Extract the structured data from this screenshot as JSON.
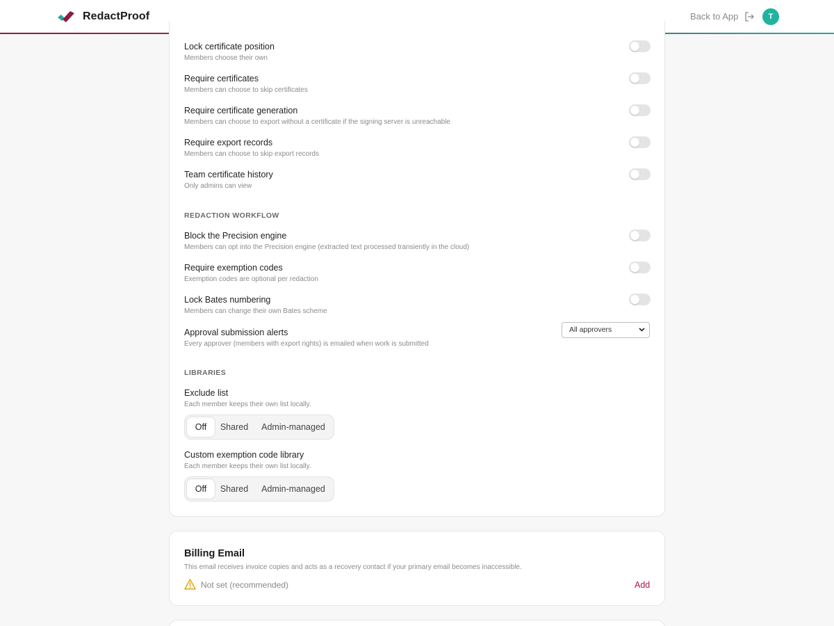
{
  "header": {
    "brand": "RedactProof",
    "back_label": "Back to App",
    "avatar_initial": "T"
  },
  "colors": {
    "brand_maroon": "#8a1c3c",
    "brand_teal": "#1fb3a0",
    "link_red": "#b3124a",
    "warning": "#e3a008"
  },
  "certificates": {
    "rows": [
      {
        "title": "Lock certificate position",
        "desc": "Members choose their own",
        "on": false
      },
      {
        "title": "Require certificates",
        "desc": "Members can choose to skip certificates",
        "on": false
      },
      {
        "title": "Require certificate generation",
        "desc": "Members can choose to export without a certificate if the signing server is unreachable",
        "on": false
      },
      {
        "title": "Require export records",
        "desc": "Members can choose to skip export records",
        "on": false
      },
      {
        "title": "Team certificate history",
        "desc": "Only admins can view",
        "on": false
      }
    ]
  },
  "workflow": {
    "section_label": "REDACTION WORKFLOW",
    "rows": [
      {
        "title": "Block the Precision engine",
        "desc": "Members can opt into the Precision engine (extracted text processed transiently in the cloud)",
        "on": false
      },
      {
        "title": "Require exemption codes",
        "desc": "Exemption codes are optional per redaction",
        "on": false
      },
      {
        "title": "Lock Bates numbering",
        "desc": "Members can change their own Bates scheme",
        "on": false
      }
    ],
    "alerts": {
      "title": "Approval submission alerts",
      "desc": "Every approver (members with export rights) is emailed when work is submitted",
      "selected": "All approvers"
    }
  },
  "libraries": {
    "section_label": "LIBRARIES",
    "exclude": {
      "title": "Exclude list",
      "desc": "Each member keeps their own list locally.",
      "options": [
        "Off",
        "Shared",
        "Admin-managed"
      ],
      "selected": "Off"
    },
    "exemption": {
      "title": "Custom exemption code library",
      "desc": "Each member keeps their own list locally.",
      "options": [
        "Off",
        "Shared",
        "Admin-managed"
      ],
      "selected": "Off"
    }
  },
  "billing": {
    "title": "Billing Email",
    "desc": "This email receives invoice copies and acts as a recovery contact if your primary email becomes inaccessible.",
    "status": "Not set (recommended)",
    "add_label": "Add",
    "icon": "warning-icon"
  }
}
